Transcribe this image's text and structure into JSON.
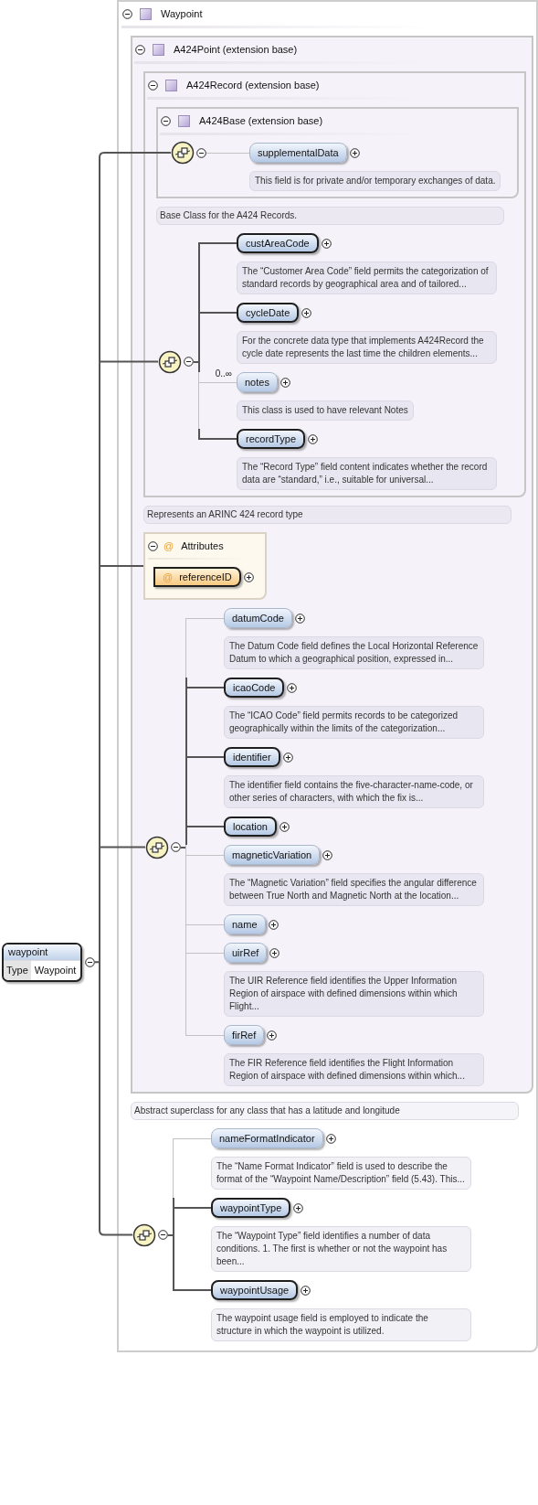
{
  "root": {
    "name": "waypoint",
    "type_label": "Type",
    "type_value": "Waypoint",
    "expanded": true
  },
  "type_box": {
    "title": "Waypoint",
    "expanded": true,
    "children": [
      {
        "kind": "extension",
        "title": "A424Point (extension base)",
        "expanded": true,
        "children": [
          {
            "kind": "extension",
            "title": "A424Record (extension base)",
            "expanded": true,
            "children": [
              {
                "kind": "extension",
                "title": "A424Base (extension base)",
                "expanded": true,
                "children": [
                  {
                    "kind": "sequence",
                    "expanded": true,
                    "elements": [
                      {
                        "name": "supplementalData",
                        "required": false,
                        "expanded": false,
                        "doc": "This field is for private and/or temporary exchanges of data."
                      }
                    ]
                  }
                ]
              },
              {
                "kind": "annotation",
                "text": "Base Class for the A424 Records."
              },
              {
                "kind": "sequence",
                "expanded": true,
                "elements": [
                  {
                    "name": "custAreaCode",
                    "required": true,
                    "expanded": false,
                    "doc": "The “Customer Area Code” field permits the categorization of standard records by geographical area and of tailored..."
                  },
                  {
                    "name": "cycleDate",
                    "required": true,
                    "expanded": false,
                    "doc": "For the concrete data type that implements A424Record the cycle date represents the last time the children elements..."
                  },
                  {
                    "name": "notes",
                    "required": false,
                    "expanded": false,
                    "occurs": "0..∞",
                    "doc": "This class is used to have relevant Notes"
                  },
                  {
                    "name": "recordType",
                    "required": true,
                    "expanded": false,
                    "doc": "The “Record Type” field content indicates whether the record data are “standard,” i.e., suitable for universal..."
                  }
                ]
              }
            ]
          },
          {
            "kind": "annotation",
            "text": "Represents an ARINC 424 record type"
          },
          {
            "kind": "attributes",
            "title": "Attributes",
            "symbol": "@",
            "expanded": true,
            "items": [
              {
                "name": "referenceID",
                "symbol": "@",
                "required": true,
                "expanded": false
              }
            ]
          },
          {
            "kind": "sequence",
            "expanded": true,
            "elements": [
              {
                "name": "datumCode",
                "required": false,
                "expanded": false,
                "doc": "The Datum Code field defines the Local Horizontal Reference Datum to which a geographical position, expressed in..."
              },
              {
                "name": "icaoCode",
                "required": true,
                "expanded": false,
                "doc": "The “ICAO Code” field permits records to be categorized geographically within the limits of the categorization..."
              },
              {
                "name": "identifier",
                "required": true,
                "expanded": false,
                "doc": "The identifier field contains the five-character-name-code, or other series of characters, with which the fix is..."
              },
              {
                "name": "location",
                "required": true,
                "expanded": false
              },
              {
                "name": "magneticVariation",
                "required": false,
                "expanded": false,
                "doc": "The “Magnetic Variation” field specifies the angular difference between True North and Magnetic North at the location..."
              },
              {
                "name": "name",
                "required": false,
                "expanded": false
              },
              {
                "name": "uirRef",
                "required": false,
                "expanded": false,
                "doc": "The UIR Reference field identifies the Upper Information Region of airspace with defined dimensions within which Flight..."
              },
              {
                "name": "firRef",
                "required": false,
                "expanded": false,
                "doc": "The FIR Reference field identifies the Flight Information Region of airspace with defined dimensions within which..."
              }
            ]
          }
        ]
      },
      {
        "kind": "annotation",
        "text": "Abstract superclass for any class that has a latitude and longitude"
      },
      {
        "kind": "sequence",
        "expanded": true,
        "elements": [
          {
            "name": "nameFormatIndicator",
            "required": false,
            "expanded": false,
            "doc": "The “Name Format Indicator” field is used to describe the format of the “Waypoint Name/Description” field (5.43). This..."
          },
          {
            "name": "waypointType",
            "required": true,
            "expanded": false,
            "doc": "The “Waypoint Type” field identifies a number of data conditions. 1. The first is whether or not the waypoint has been..."
          },
          {
            "name": "waypointUsage",
            "required": true,
            "expanded": false,
            "doc": "The waypoint usage field is employed to indicate the structure in which the waypoint is utilized."
          }
        ]
      }
    ]
  }
}
